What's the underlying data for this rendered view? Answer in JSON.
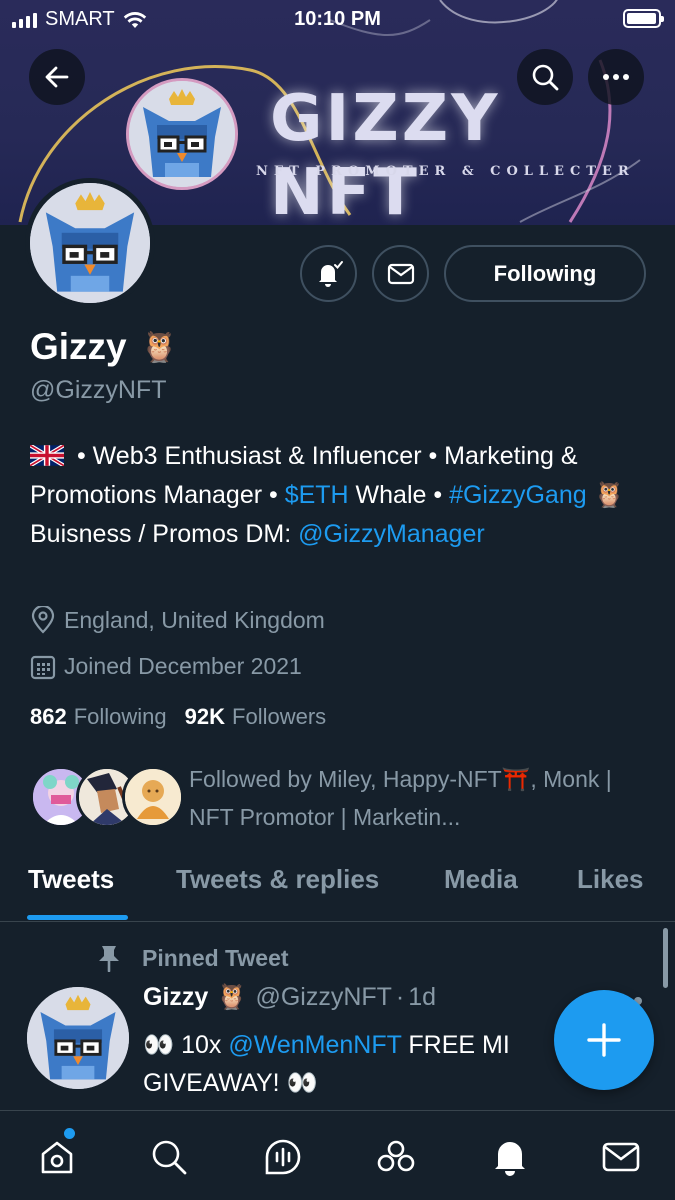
{
  "status_bar": {
    "carrier": "SMART",
    "time": "10:10 PM",
    "battery_level": 0.95
  },
  "banner": {
    "title": "GIZZY NFT",
    "subtitle": "NFT PROMOTER & COLLECTER",
    "icons": [
      "back-arrow-icon",
      "search-icon",
      "more-icon"
    ]
  },
  "profile": {
    "name": "Gizzy",
    "name_emoji": "🦉",
    "handle": "@GizzyNFT",
    "following_button": "Following",
    "bio": {
      "flag": "🇬🇧",
      "part1": " • Web3 Enthusiast & Influencer • Marketing & Promotions Manager • ",
      "eth_link": "$ETH",
      "part2": " Whale • ",
      "gang_link": "#GizzyGang",
      "owl": " 🦉",
      "part3": " Buisness / Promos DM: ",
      "manager_link": "@GizzyManager"
    },
    "location": "England, United Kingdom",
    "joined": "Joined December 2021",
    "following_count": "862",
    "following_label": "Following",
    "followers_count": "92K",
    "followers_label": "Followers",
    "followed_by": "Followed by Miley, Happy-NFT⛩️, Monk | NFT Promotor | Marketin..."
  },
  "tabs": [
    {
      "label": "Tweets",
      "active": true
    },
    {
      "label": "Tweets & replies",
      "active": false
    },
    {
      "label": "Media",
      "active": false
    },
    {
      "label": "Likes",
      "active": false
    }
  ],
  "pinned_tweet": {
    "pinned_label": "Pinned Tweet",
    "author_name": "Gizzy",
    "author_emoji": "🦉",
    "author_handle": "@GizzyNFT",
    "dot": "·",
    "time": "1d",
    "text_eyes_start": "👀",
    "text_part1": " 10x ",
    "text_link": "@WenMenNFT",
    "text_part2": " FREE MI",
    "text_line2": "GIVEAWAY! 👀"
  },
  "bottom_nav": {
    "items": [
      "home-icon",
      "search-icon",
      "spaces-icon",
      "communities-icon",
      "notifications-icon",
      "messages-icon"
    ],
    "active": "notifications-icon"
  },
  "colors": {
    "background": "#15202b",
    "accent": "#1d9bf0",
    "secondary_text": "#8899a6",
    "border": "#38444d"
  }
}
